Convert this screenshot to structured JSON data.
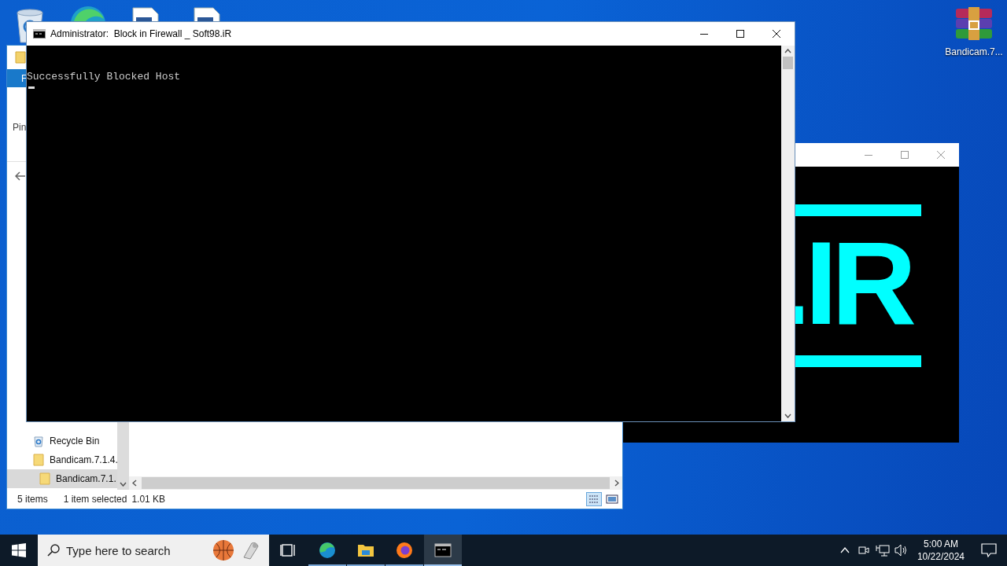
{
  "desktop": {
    "icons": [
      {
        "kind": "recycle"
      },
      {
        "kind": "edge"
      },
      {
        "kind": "document"
      },
      {
        "kind": "document"
      },
      {
        "kind": "archive",
        "label": "Bandicam.7..."
      }
    ]
  },
  "logo_console": {
    "art_text": ".IR"
  },
  "explorer": {
    "ribbon_tab": "F",
    "ribbon_label": "Pin",
    "nav_items": [
      {
        "kind": "recycle",
        "label": "Recycle Bin",
        "selected": false
      },
      {
        "kind": "folder",
        "label": "Bandicam.7.1.4.",
        "selected": false,
        "children": [
          {
            "kind": "folder",
            "label": "Bandicam.7.1.",
            "selected": true
          }
        ]
      }
    ],
    "status": {
      "item_count": "5 items",
      "selection": "1 item selected",
      "size": "1.01 KB"
    }
  },
  "console": {
    "title": "Administrator:  Block in Firewall _ Soft98.iR",
    "lines": [
      "Successfully Blocked Host"
    ]
  },
  "taskbar": {
    "search_placeholder": "Type here to search",
    "apps": [
      {
        "kind": "taskview",
        "running": false,
        "selected": false
      },
      {
        "kind": "edge",
        "running": true,
        "selected": false
      },
      {
        "kind": "folder",
        "running": true,
        "selected": false
      },
      {
        "kind": "firefox",
        "running": true,
        "selected": false
      },
      {
        "kind": "console",
        "running": true,
        "selected": true
      }
    ],
    "time": "5:00 AM",
    "date": "10/22/2024"
  }
}
